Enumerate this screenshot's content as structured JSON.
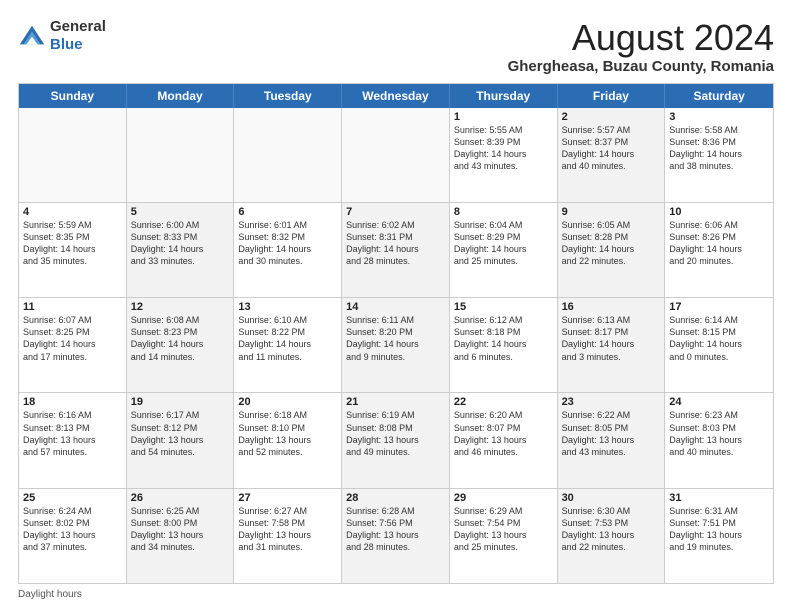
{
  "header": {
    "logo_line1": "General",
    "logo_line2": "Blue",
    "month_year": "August 2024",
    "location": "Ghergheasa, Buzau County, Romania"
  },
  "days_of_week": [
    "Sunday",
    "Monday",
    "Tuesday",
    "Wednesday",
    "Thursday",
    "Friday",
    "Saturday"
  ],
  "footer": {
    "daylight_label": "Daylight hours"
  },
  "rows": [
    [
      {
        "day": "",
        "info": "",
        "empty": true
      },
      {
        "day": "",
        "info": "",
        "empty": true
      },
      {
        "day": "",
        "info": "",
        "empty": true
      },
      {
        "day": "",
        "info": "",
        "empty": true
      },
      {
        "day": "1",
        "info": "Sunrise: 5:55 AM\nSunset: 8:39 PM\nDaylight: 14 hours\nand 43 minutes."
      },
      {
        "day": "2",
        "info": "Sunrise: 5:57 AM\nSunset: 8:37 PM\nDaylight: 14 hours\nand 40 minutes.",
        "shaded": true
      },
      {
        "day": "3",
        "info": "Sunrise: 5:58 AM\nSunset: 8:36 PM\nDaylight: 14 hours\nand 38 minutes."
      }
    ],
    [
      {
        "day": "4",
        "info": "Sunrise: 5:59 AM\nSunset: 8:35 PM\nDaylight: 14 hours\nand 35 minutes."
      },
      {
        "day": "5",
        "info": "Sunrise: 6:00 AM\nSunset: 8:33 PM\nDaylight: 14 hours\nand 33 minutes.",
        "shaded": true
      },
      {
        "day": "6",
        "info": "Sunrise: 6:01 AM\nSunset: 8:32 PM\nDaylight: 14 hours\nand 30 minutes."
      },
      {
        "day": "7",
        "info": "Sunrise: 6:02 AM\nSunset: 8:31 PM\nDaylight: 14 hours\nand 28 minutes.",
        "shaded": true
      },
      {
        "day": "8",
        "info": "Sunrise: 6:04 AM\nSunset: 8:29 PM\nDaylight: 14 hours\nand 25 minutes."
      },
      {
        "day": "9",
        "info": "Sunrise: 6:05 AM\nSunset: 8:28 PM\nDaylight: 14 hours\nand 22 minutes.",
        "shaded": true
      },
      {
        "day": "10",
        "info": "Sunrise: 6:06 AM\nSunset: 8:26 PM\nDaylight: 14 hours\nand 20 minutes."
      }
    ],
    [
      {
        "day": "11",
        "info": "Sunrise: 6:07 AM\nSunset: 8:25 PM\nDaylight: 14 hours\nand 17 minutes."
      },
      {
        "day": "12",
        "info": "Sunrise: 6:08 AM\nSunset: 8:23 PM\nDaylight: 14 hours\nand 14 minutes.",
        "shaded": true
      },
      {
        "day": "13",
        "info": "Sunrise: 6:10 AM\nSunset: 8:22 PM\nDaylight: 14 hours\nand 11 minutes."
      },
      {
        "day": "14",
        "info": "Sunrise: 6:11 AM\nSunset: 8:20 PM\nDaylight: 14 hours\nand 9 minutes.",
        "shaded": true
      },
      {
        "day": "15",
        "info": "Sunrise: 6:12 AM\nSunset: 8:18 PM\nDaylight: 14 hours\nand 6 minutes."
      },
      {
        "day": "16",
        "info": "Sunrise: 6:13 AM\nSunset: 8:17 PM\nDaylight: 14 hours\nand 3 minutes.",
        "shaded": true
      },
      {
        "day": "17",
        "info": "Sunrise: 6:14 AM\nSunset: 8:15 PM\nDaylight: 14 hours\nand 0 minutes."
      }
    ],
    [
      {
        "day": "18",
        "info": "Sunrise: 6:16 AM\nSunset: 8:13 PM\nDaylight: 13 hours\nand 57 minutes."
      },
      {
        "day": "19",
        "info": "Sunrise: 6:17 AM\nSunset: 8:12 PM\nDaylight: 13 hours\nand 54 minutes.",
        "shaded": true
      },
      {
        "day": "20",
        "info": "Sunrise: 6:18 AM\nSunset: 8:10 PM\nDaylight: 13 hours\nand 52 minutes."
      },
      {
        "day": "21",
        "info": "Sunrise: 6:19 AM\nSunset: 8:08 PM\nDaylight: 13 hours\nand 49 minutes.",
        "shaded": true
      },
      {
        "day": "22",
        "info": "Sunrise: 6:20 AM\nSunset: 8:07 PM\nDaylight: 13 hours\nand 46 minutes."
      },
      {
        "day": "23",
        "info": "Sunrise: 6:22 AM\nSunset: 8:05 PM\nDaylight: 13 hours\nand 43 minutes.",
        "shaded": true
      },
      {
        "day": "24",
        "info": "Sunrise: 6:23 AM\nSunset: 8:03 PM\nDaylight: 13 hours\nand 40 minutes."
      }
    ],
    [
      {
        "day": "25",
        "info": "Sunrise: 6:24 AM\nSunset: 8:02 PM\nDaylight: 13 hours\nand 37 minutes."
      },
      {
        "day": "26",
        "info": "Sunrise: 6:25 AM\nSunset: 8:00 PM\nDaylight: 13 hours\nand 34 minutes.",
        "shaded": true
      },
      {
        "day": "27",
        "info": "Sunrise: 6:27 AM\nSunset: 7:58 PM\nDaylight: 13 hours\nand 31 minutes."
      },
      {
        "day": "28",
        "info": "Sunrise: 6:28 AM\nSunset: 7:56 PM\nDaylight: 13 hours\nand 28 minutes.",
        "shaded": true
      },
      {
        "day": "29",
        "info": "Sunrise: 6:29 AM\nSunset: 7:54 PM\nDaylight: 13 hours\nand 25 minutes."
      },
      {
        "day": "30",
        "info": "Sunrise: 6:30 AM\nSunset: 7:53 PM\nDaylight: 13 hours\nand 22 minutes.",
        "shaded": true
      },
      {
        "day": "31",
        "info": "Sunrise: 6:31 AM\nSunset: 7:51 PM\nDaylight: 13 hours\nand 19 minutes."
      }
    ]
  ]
}
